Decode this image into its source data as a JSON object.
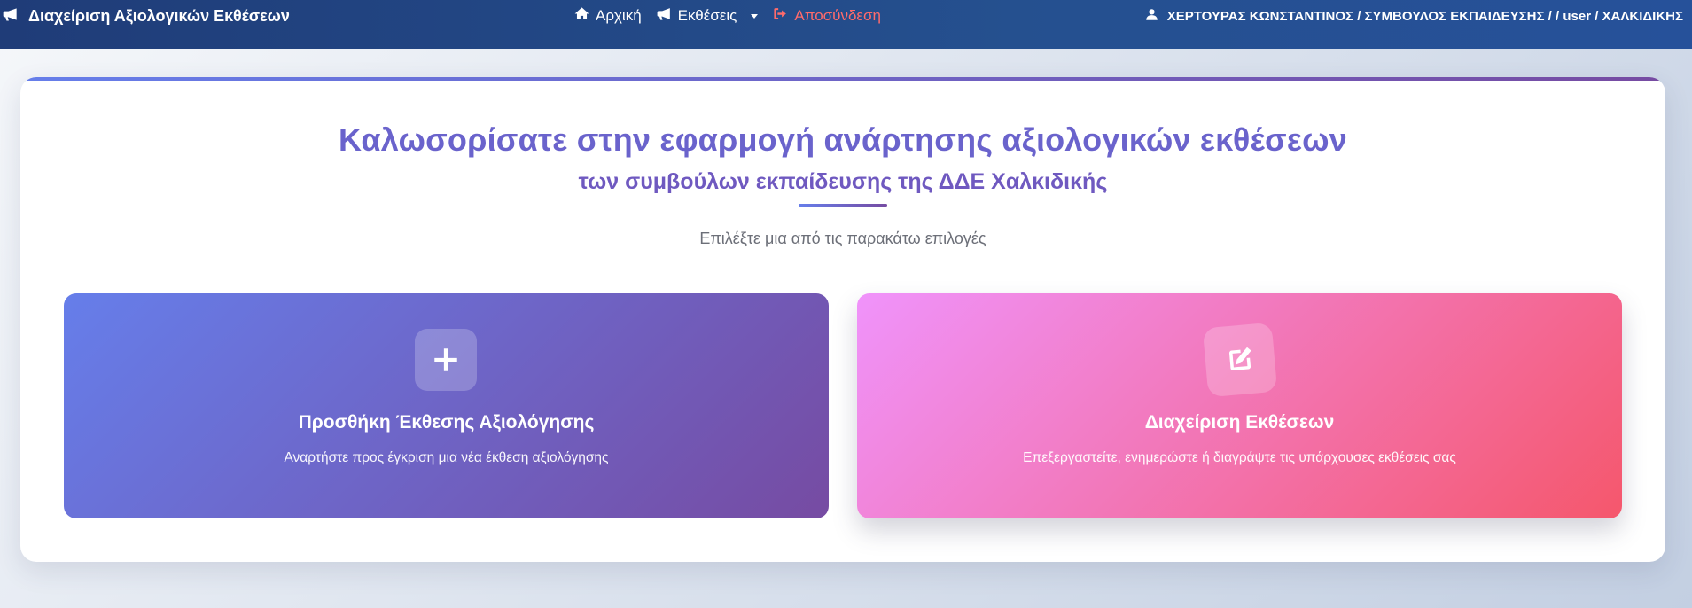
{
  "navbar": {
    "brand": "Διαχείριση Αξιολογικών Εκθέσεων",
    "brand_icon": "megaphone-icon",
    "links": [
      {
        "label": "Αρχική",
        "icon": "home-icon"
      },
      {
        "label": "Εκθέσεις",
        "icon": "megaphone-icon"
      },
      {
        "label": "Αποσύνδεση",
        "icon": "sign-out-icon"
      }
    ],
    "user": "ΧΕΡΤΟΥΡΑΣ ΚΩΝΣΤΑΝΤΙΝΟΣ / ΣΥΜΒΟΥΛΟΣ ΕΚΠΑΙΔΕΥΣΗΣ / / user / ΧΑΛΚΙΔΙΚΗΣ",
    "user_icon": "user-icon",
    "logout_color": "#ff6b6b"
  },
  "welcome": {
    "title": "Καλωσορίσατε στην εφαρμογή ανάρτησης αξιολογικών εκθέσεων",
    "subtitle": "των συμβούλων εκπαίδευσης της ΔΔΕ Χαλκιδικής",
    "prompt": "Επιλέξτε μια από τις παρακάτω επιλογές"
  },
  "options": [
    {
      "title": "Προσθήκη Έκθεσης Αξιολόγησης",
      "description": "Αναρτήστε προς έγκριση μια νέα έκθεση αξιολόγησης",
      "icon": "plus-icon",
      "gradient": [
        "#667eea",
        "#764ba2"
      ]
    },
    {
      "title": "Διαχείριση Εκθέσεων",
      "description": "Επεξεργαστείτε, ενημερώστε ή διαγράψτε τις υπάρχουσες εκθέσεις σας",
      "icon": "edit-icon",
      "gradient": [
        "#f093fb",
        "#f5576c"
      ]
    }
  ]
}
